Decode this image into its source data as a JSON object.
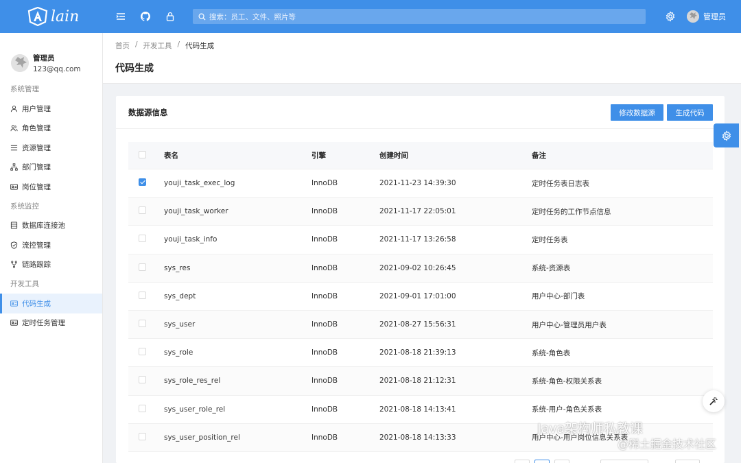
{
  "app": {
    "logo_text": "lain",
    "brand_color": "#3f8fe8"
  },
  "topbar": {
    "search_placeholder": "搜索：员工、文件、照片等",
    "user_name": "管理员",
    "icons": [
      "menu-icon",
      "github-icon",
      "lock-icon",
      "search-icon",
      "gear-icon"
    ]
  },
  "sidebar": {
    "user": {
      "name": "管理员",
      "email": "123@qq.com"
    },
    "groups": [
      {
        "title": "系统管理",
        "items": [
          "用户管理",
          "角色管理",
          "资源管理",
          "部门管理",
          "岗位管理"
        ]
      },
      {
        "title": "系统监控",
        "items": [
          "数据库连接池",
          "流控管理",
          "链路跟踪"
        ]
      },
      {
        "title": "开发工具",
        "items": [
          "代码生成",
          "定时任务管理"
        ]
      }
    ],
    "active_item": "代码生成"
  },
  "breadcrumb": [
    "首页",
    "开发工具",
    "代码生成"
  ],
  "page_title": "代码生成",
  "card": {
    "title": "数据源信息",
    "btn_edit": "修改数据源",
    "btn_generate": "生成代码"
  },
  "table": {
    "columns": [
      "表名",
      "引擎",
      "创建时间",
      "备注"
    ],
    "rows": [
      {
        "checked": true,
        "name": "youji_task_exec_log",
        "engine": "InnoDB",
        "created": "2021-11-23 14:39:30",
        "note": "定时任务表日志表"
      },
      {
        "checked": false,
        "name": "youji_task_worker",
        "engine": "InnoDB",
        "created": "2021-11-17 22:05:01",
        "note": "定时任务的工作节点信息"
      },
      {
        "checked": false,
        "name": "youji_task_info",
        "engine": "InnoDB",
        "created": "2021-11-17 13:26:58",
        "note": "定时任务表"
      },
      {
        "checked": false,
        "name": "sys_res",
        "engine": "InnoDB",
        "created": "2021-09-02 10:26:45",
        "note": "系统-资源表"
      },
      {
        "checked": false,
        "name": "sys_dept",
        "engine": "InnoDB",
        "created": "2021-09-01 17:01:00",
        "note": "用户中心-部门表"
      },
      {
        "checked": false,
        "name": "sys_user",
        "engine": "InnoDB",
        "created": "2021-08-27 15:56:31",
        "note": "用户中心-管理员用户表"
      },
      {
        "checked": false,
        "name": "sys_role",
        "engine": "InnoDB",
        "created": "2021-08-18 21:39:13",
        "note": "系统-角色表"
      },
      {
        "checked": false,
        "name": "sys_role_res_rel",
        "engine": "InnoDB",
        "created": "2021-08-18 21:12:31",
        "note": "系统-角色-权限关系表"
      },
      {
        "checked": false,
        "name": "sys_user_role_rel",
        "engine": "InnoDB",
        "created": "2021-08-18 14:13:41",
        "note": "系统-用户-角色关系表"
      },
      {
        "checked": false,
        "name": "sys_user_position_rel",
        "engine": "InnoDB",
        "created": "2021-08-18 14:13:33",
        "note": "用户中心-用户岗位信息关系表"
      }
    ]
  },
  "watermark": {
    "line1": "Java架构师私教课",
    "line2": "@稀土掘金技术社区"
  }
}
